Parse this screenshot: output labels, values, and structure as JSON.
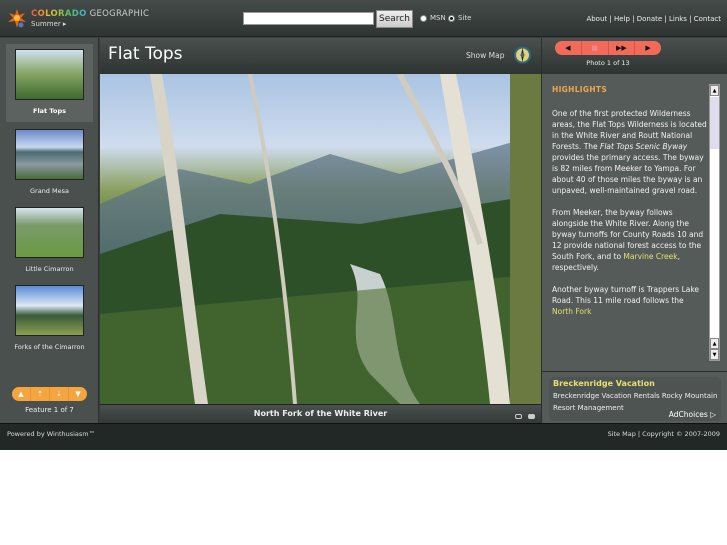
{
  "header": {
    "brand_colored": "COLORADO",
    "brand_rest": "GEOGRAPHIC",
    "season": "Summer ▸",
    "search_placeholder": "",
    "search_label": "Search",
    "radio_msn": "MSN",
    "radio_site": "Site",
    "links": "About | Help | Donate | Links | Contact"
  },
  "sidebar": {
    "items": [
      {
        "label": "Flat Tops",
        "selected": true
      },
      {
        "label": "Grand Mesa"
      },
      {
        "label": "Little Cimarron"
      },
      {
        "label": "Forks of the Cimarron"
      }
    ],
    "nav": [
      "▲",
      "⇡",
      "⇣",
      "▼"
    ],
    "count": "Feature 1 of 7"
  },
  "main": {
    "title": "Flat Tops",
    "show_map": "Show Map",
    "caption": "North Fork of the White River"
  },
  "photo_nav": {
    "buttons": [
      "◀",
      "■",
      "▶▶",
      "▶"
    ],
    "count": "Photo 1 of 13"
  },
  "highlights": {
    "heading": "HIGHLIGHTS",
    "p1a": "One of the first protected Wilderness areas, the Flat Tops Wilderness is located in the White River and Routt National Forests. The ",
    "p1i": "Flat Tops Scenic Byway",
    "p1b": " provides the primary access. The byway is 82 miles from Meeker to Yampa. For about 40 of those miles the byway is an unpaved, well-maintained gravel road.",
    "p2a": "From Meeker, the byway follows alongside the White River. Along the byway turnoffs for County Roads 10 and 12 provide national forest access to the South Fork, and to ",
    "p2link": "Marvine Creek",
    "p2b": ", respectively.",
    "p3a": "Another byway turnoff is Trappers Lake Road. This 11 mile road follows the ",
    "p3link": "North Fork"
  },
  "ad": {
    "title": "Breckenridge Vacation",
    "text": "Breckenridge Vacation Rentals Rocky Mountain Resort Management",
    "choices": "AdChoices ▷"
  },
  "footer": {
    "powered": "Powered by Winthusiasm™",
    "copyright": "Site Map | Copyright © 2007-2009"
  },
  "colors": {
    "accent_orange": "#f4a540",
    "photo_nav_red": "#f26b5a",
    "link_yellow": "#e6e070",
    "header_dark": "#2f3533"
  }
}
